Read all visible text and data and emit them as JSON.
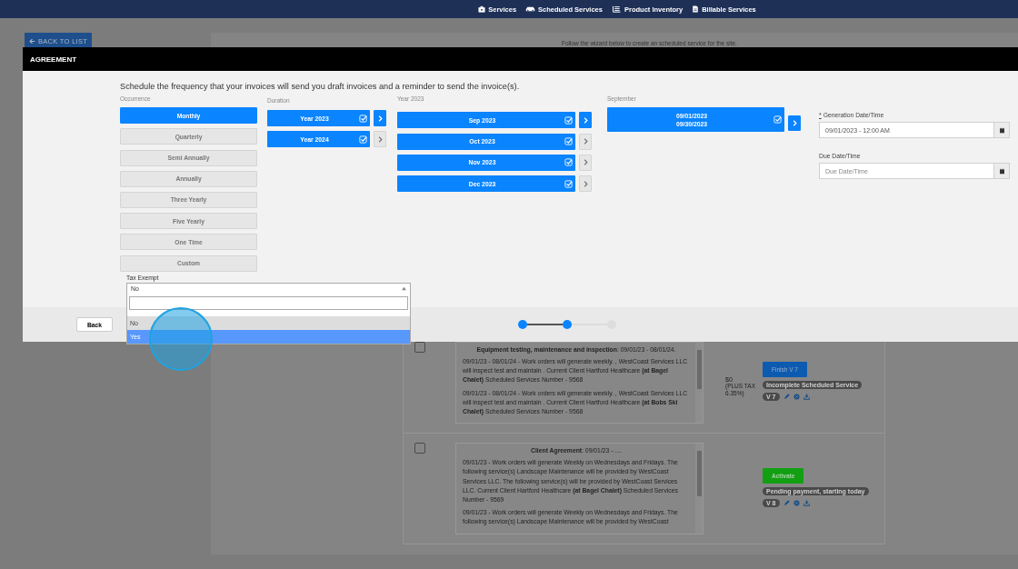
{
  "nav": {
    "items": [
      {
        "label": "Services",
        "kind": "briefcase"
      },
      {
        "label": "Scheduled Services",
        "kind": "car"
      },
      {
        "label": "Product Inventory",
        "kind": "list"
      },
      {
        "label": "Billable Services",
        "kind": "document"
      }
    ]
  },
  "page": {
    "back_button": "BACK TO LIST",
    "intro": "Follow the wizard below to create an scheduled service for the site.",
    "services": [
      {
        "checked": false,
        "heading": "**Equipment testing, maintenance and inspection**: 09/01/23 - 08/01/24.",
        "paragraphs": [
          "09/01/23 - 08/01/24 - Work orders will generate weekly. , WestCoast Services LLC will inspect test and maintain . Current Client Hartford Healthcare **(at Bagel Chalet)** Scheduled Services Number - 9568",
          "09/01/23 - 08/01/24 - Work orders will generate weekly. , WestCoast Services LLC will inspect test and maintain . Current Client Hartford Healthcare **(at Bobs Ski Chalet)** Scheduled Services Number - 9568"
        ],
        "price": "$0",
        "tax_note": "(PLUS TAX 6.35%)",
        "action": {
          "label": "Finish V 7",
          "kind": "finish"
        },
        "status": "Incomplete Scheduled Service",
        "version": "V 7"
      },
      {
        "checked": false,
        "heading": "**Client Agreement**: 09/01/23 - ....",
        "paragraphs": [
          "09/01/23 - Work orders will generate Weekly on Wednesdays and Fridays. The following service(s) Landscape Maintenance will be provided by WestCoast Services LLC. The following service(s) will be provided by WestCoast Services LLC. Current Client Hartford Healthcare **(at Bagel Chalet)** Scheduled Services Number - 9569",
          "09/01/23 - Work orders will generate Weekly on Wednesdays and Fridays. The following service(s) Landscape Maintenance will be provided by WestCoast"
        ],
        "action": {
          "label": "Activate",
          "kind": "activate"
        },
        "status": "Pending payment, starting today",
        "version": "V 8"
      }
    ]
  },
  "modal": {
    "title": "AGREEMENT",
    "instructions": "Schedule the frequency that your invoices will send you draft invoices and a reminder to send the invoice(s).",
    "occurrence": {
      "label": "Occurrence",
      "options": [
        {
          "label": "Monthly",
          "selected": true
        },
        {
          "label": "Quarterly",
          "selected": false
        },
        {
          "label": "Semi Annually",
          "selected": false
        },
        {
          "label": "Annually",
          "selected": false
        },
        {
          "label": "Three Yearly",
          "selected": false
        },
        {
          "label": "Five Yearly",
          "selected": false
        },
        {
          "label": "One Time",
          "selected": false
        },
        {
          "label": "Custom",
          "selected": false
        }
      ]
    },
    "duration": {
      "label": "Duration",
      "items": [
        {
          "label": "Year 2023",
          "checked": true,
          "expanded": true
        },
        {
          "label": "Year 2024",
          "checked": true,
          "expanded": false
        }
      ]
    },
    "months": {
      "label": "Year 2023",
      "items": [
        {
          "label": "Sep 2023",
          "checked": true,
          "expanded": true
        },
        {
          "label": "Oct 2023",
          "checked": true,
          "expanded": false
        },
        {
          "label": "Nov 2023",
          "checked": true,
          "expanded": false
        },
        {
          "label": "Dec 2023",
          "checked": true,
          "expanded": false
        }
      ]
    },
    "periods": {
      "label": "September",
      "items": [
        {
          "start": "09/01/2023",
          "end": "09/30/2023",
          "checked": true,
          "expanded": true
        }
      ]
    },
    "generation": {
      "required_mark": "*",
      "label": "Generation Date/Time",
      "value": "09/01/2023 - 12:00 AM"
    },
    "due": {
      "label": "Due Date/Time",
      "placeholder": "Due Date/Time"
    },
    "tax_exempt": {
      "label": "Tax Exempt",
      "value": "No",
      "open": true,
      "options": [
        {
          "label": "No",
          "selected": true,
          "highlighted": false
        },
        {
          "label": "Yes",
          "selected": false,
          "highlighted": true
        }
      ]
    },
    "back_button": "Back",
    "steps": [
      {
        "done": true
      },
      {
        "done": true
      },
      {
        "done": false
      }
    ]
  }
}
